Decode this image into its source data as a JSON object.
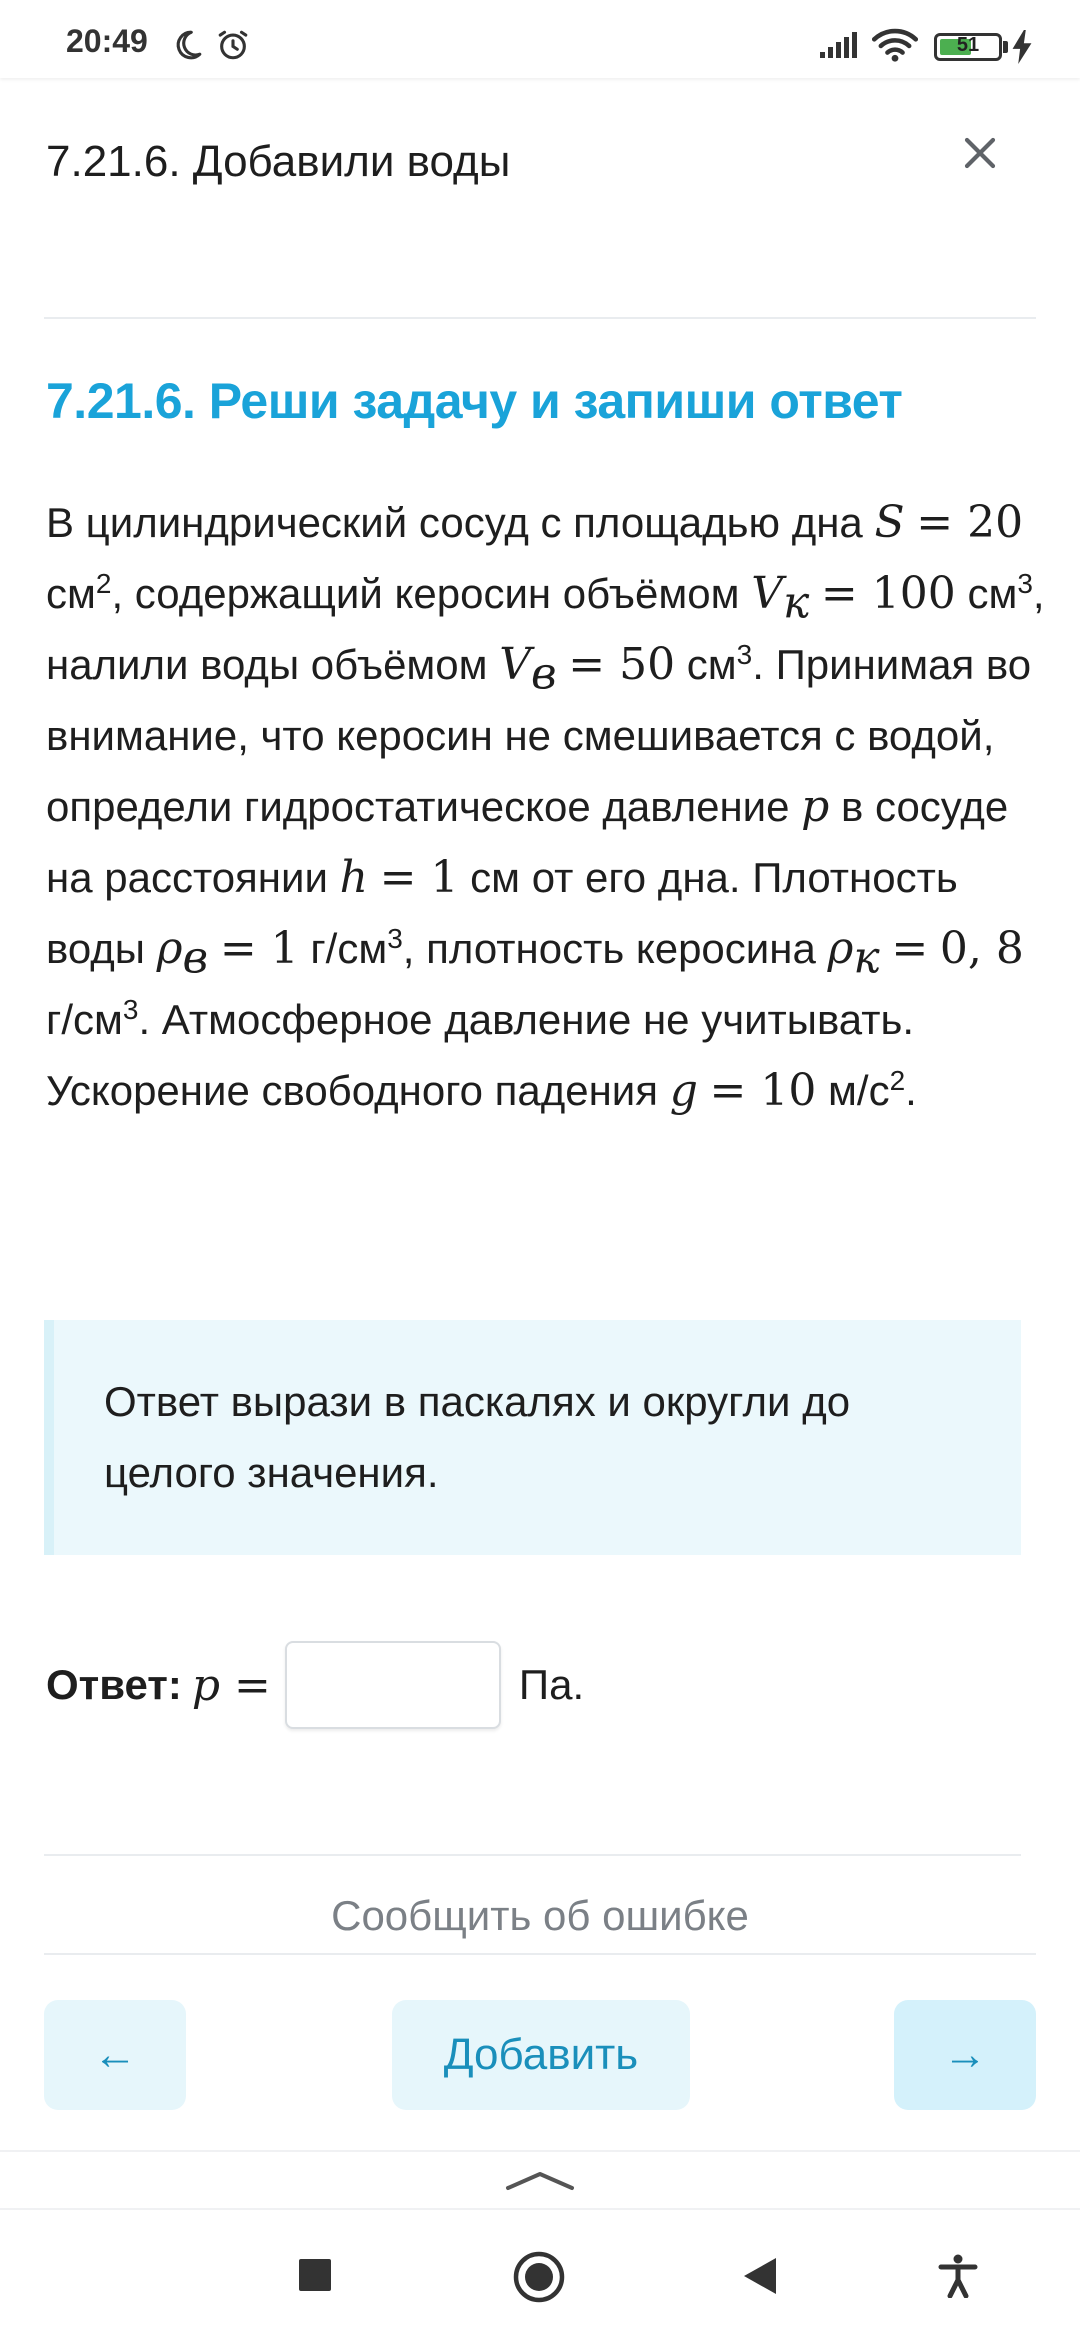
{
  "status_bar": {
    "time": "20:49",
    "battery_level": "51",
    "icons": [
      "moon-icon",
      "alarm-icon",
      "signal-icon",
      "wifi-icon",
      "battery-icon",
      "charging-bolt-icon"
    ]
  },
  "header": {
    "title": "7.21.6. Добавили воды",
    "close_icon": "close-icon"
  },
  "task": {
    "heading": "7.21.6. Реши задачу и запиши ответ",
    "problem": {
      "t1": "В цилиндрический сосуд с площадью дна",
      "S_var": "S",
      "S_eq": "= 20",
      "S_unit": "см",
      "S_exp": "2",
      "t2": ", содержащий керосин объёмом",
      "Vk_var": "V",
      "Vk_sub": "к",
      "Vk_eq": "= 100",
      "Vk_unit": "см",
      "Vk_exp": "3",
      "t3": ", налили воды объёмом",
      "Vv_var": "V",
      "Vv_sub": "в",
      "Vv_eq": "= 50",
      "Vv_unit": "см",
      "Vv_exp": "3",
      "t4": ". Принимая во внимание, что керосин не смешивается с водой, определи гидростатическое давление",
      "p_var": "p",
      "t5": "в сосуде на расстоянии",
      "h_var": "h",
      "h_eq": "= 1",
      "h_unit": "см",
      "t6": "от его дна. Плотность воды",
      "rv_var": "ρ",
      "rv_sub": "в",
      "rv_eq": "= 1",
      "rv_unit": "г/см",
      "rv_exp": "3",
      "t7": ", плотность керосина",
      "rk_var": "ρ",
      "rk_sub": "к",
      "rk_eq": "=",
      "rk_val": "0, 8",
      "rk_unit": "г/см",
      "rk_exp": "3",
      "t8": ". Атмосферное давление не учитывать. Ускорение свободного падения",
      "g_var": "g",
      "g_eq": "= 10",
      "g_unit": "м/с",
      "g_exp": "2",
      "t9": "."
    }
  },
  "hint": {
    "text": "Ответ вырази в паскалях и округли до целого значения."
  },
  "answer": {
    "label": "Ответ:",
    "variable": "p =",
    "value": "",
    "unit": "Па."
  },
  "report_link": "Сообщить об ошибке",
  "buttons": {
    "prev": "←",
    "add": "Добавить",
    "next": "→"
  },
  "colors": {
    "accent": "#1aa3d9",
    "button_bg": "#e6f6fb",
    "button_text": "#1a8fbb",
    "hint_bg": "#ebf8fc"
  },
  "nav_bar": {
    "icons": [
      "recents-square-icon",
      "home-circle-icon",
      "back-triangle-icon",
      "accessibility-icon"
    ]
  }
}
